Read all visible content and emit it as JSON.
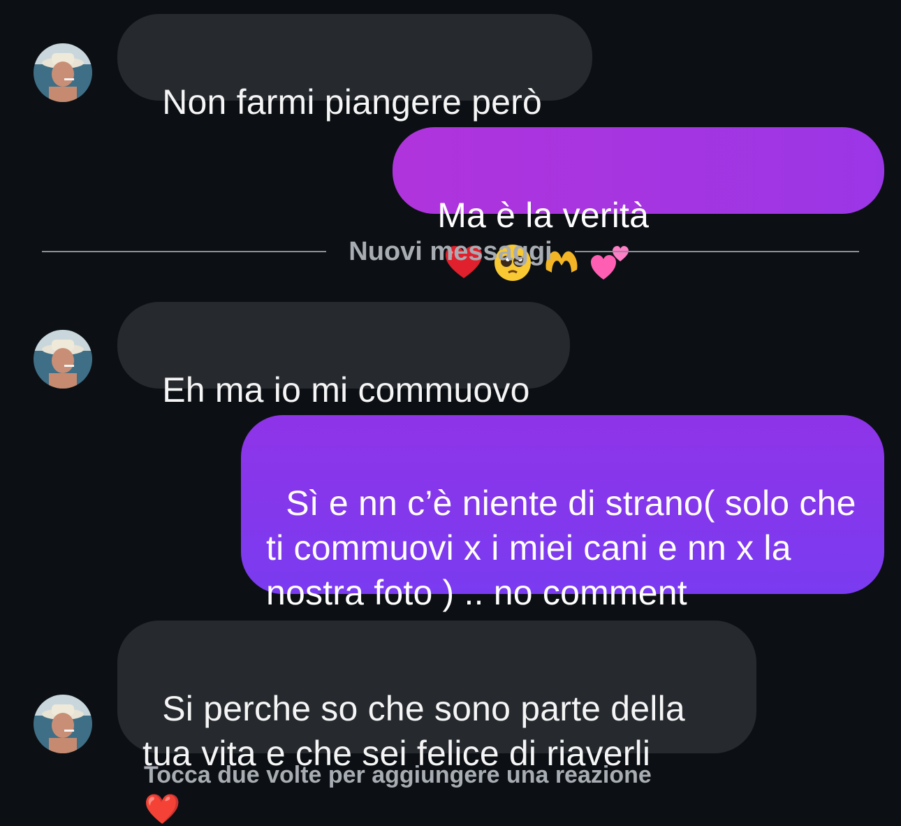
{
  "thread": {
    "messages": [
      {
        "id": "m1",
        "direction": "in",
        "text": "Non farmi piangere però"
      },
      {
        "id": "m2",
        "direction": "out",
        "text": "Ma è la verità",
        "emojis": [
          "red-heart",
          "pleading-face",
          "heart-hands",
          "two-hearts"
        ]
      },
      {
        "id": "m3",
        "direction": "in",
        "text": "Eh ma io mi commuovo"
      },
      {
        "id": "m4",
        "direction": "out",
        "text": "Sì e nn c’è niente di strano( solo che ti commuovi x i miei cani e nn x la nostra foto ) .. no comment"
      },
      {
        "id": "m5",
        "direction": "in",
        "text": "Si perche so che sono parte della tua vita e che sei felice di riaverli"
      }
    ],
    "new_messages_label": "Nuovi messaggi",
    "reaction_hint": "Tocca due volte per aggiungere una reazione",
    "reaction_emoji": "❤️"
  },
  "colors": {
    "background": "#0c1014",
    "incoming_bubble": "#262a2f",
    "outgoing_gradient_top": "#a734e3",
    "outgoing_gradient_bottom": "#7b3af0",
    "hint_text": "#a8adb3"
  }
}
